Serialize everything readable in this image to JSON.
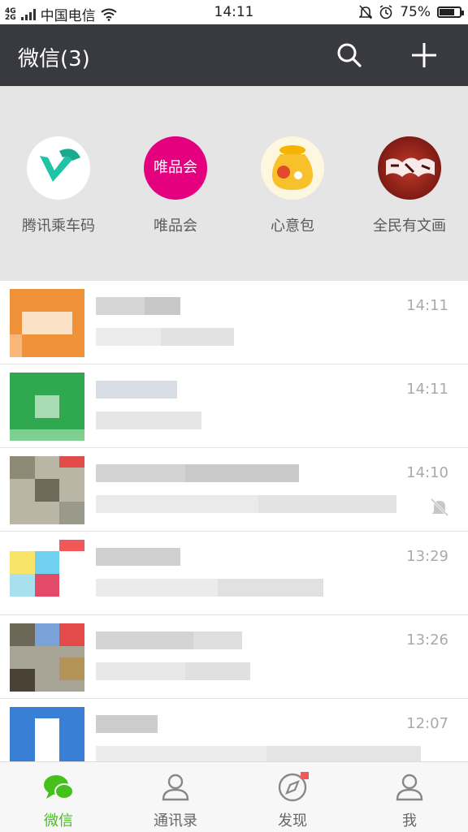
{
  "status_bar": {
    "carrier": "中国电信",
    "network": "4G",
    "network2": "2G",
    "time": "14:11",
    "battery": "75%",
    "battery_level": 0.75
  },
  "header": {
    "title": "微信(3)"
  },
  "mini_programs": [
    {
      "label": "腾讯乘车码",
      "icon": "tencent-ride-code-icon"
    },
    {
      "label": "唯品会",
      "icon": "vipshop-icon",
      "icon_text": "唯品会"
    },
    {
      "label": "心意包",
      "icon": "money-bag-icon"
    },
    {
      "label": "全民有文画",
      "icon": "quanmin-wenhua-icon"
    }
  ],
  "chats": [
    {
      "time": "14:11",
      "muted": false
    },
    {
      "time": "14:11",
      "muted": false
    },
    {
      "time": "14:10",
      "muted": true
    },
    {
      "time": "13:29",
      "muted": false
    },
    {
      "time": "13:26",
      "muted": false
    },
    {
      "time": "12:07",
      "muted": false
    }
  ],
  "tabs": [
    {
      "label": "微信",
      "active": true
    },
    {
      "label": "通讯录",
      "active": false
    },
    {
      "label": "发现",
      "active": false
    },
    {
      "label": "我",
      "active": false
    }
  ],
  "colors": {
    "header_bg": "#393a3f",
    "accent_green": "#46c01b",
    "mini_bg": "#e5e5e5"
  }
}
